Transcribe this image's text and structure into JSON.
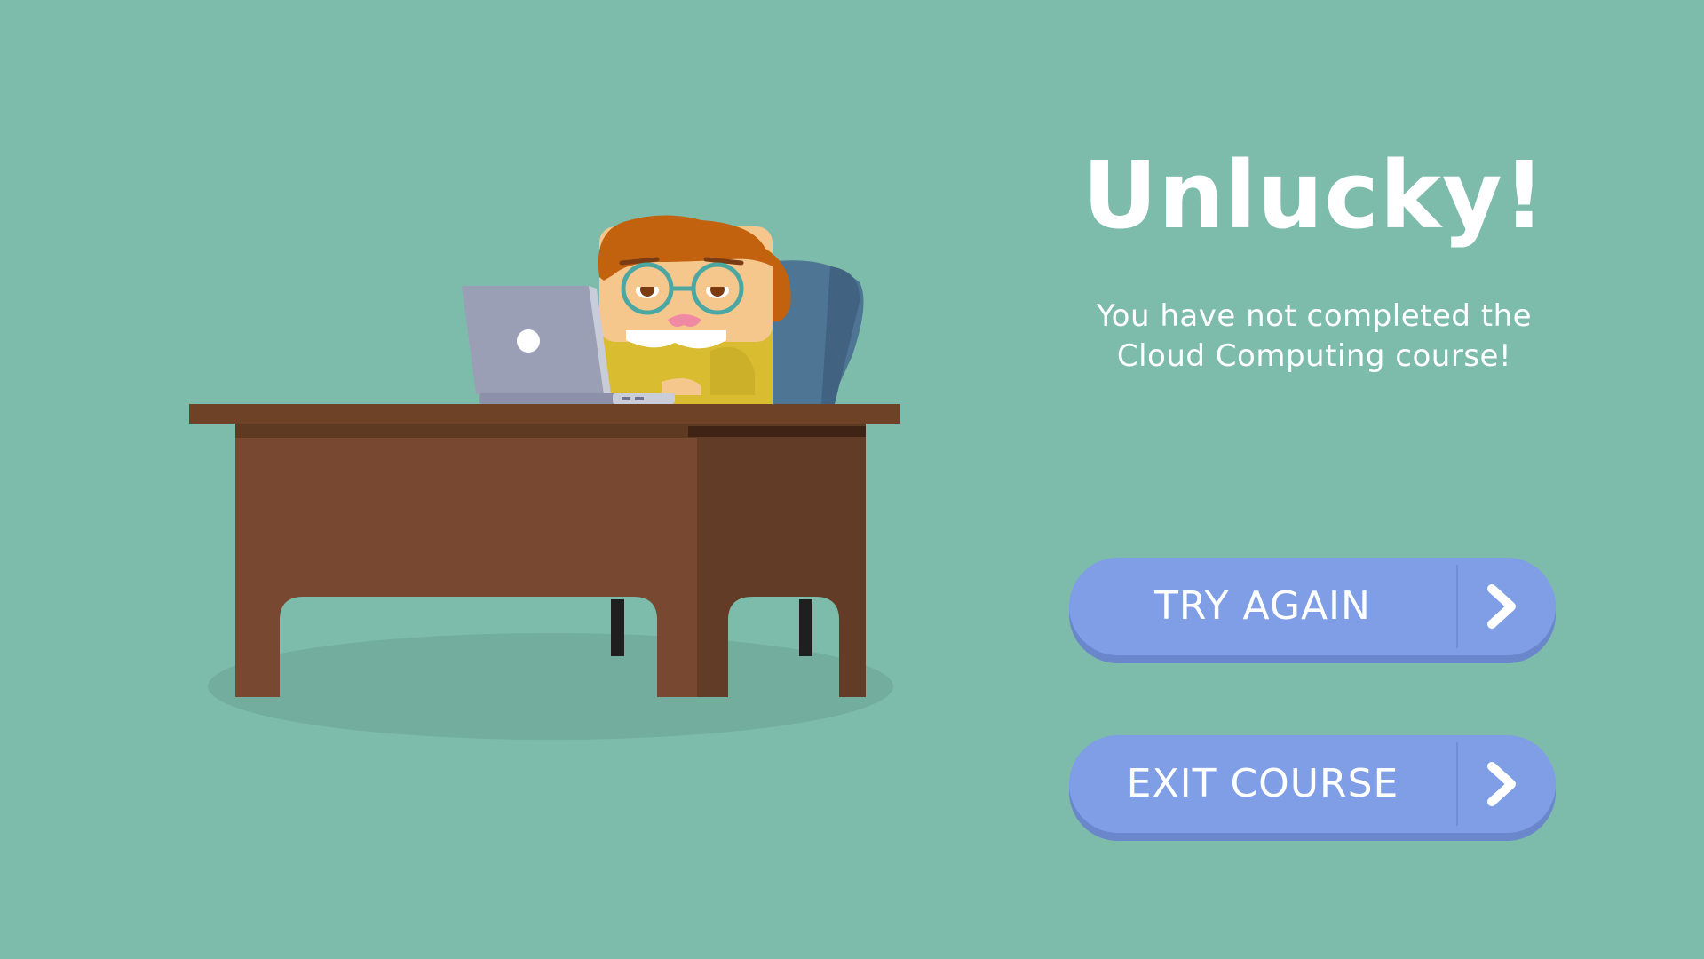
{
  "result": {
    "title": "Unlucky!",
    "message_line1": "You have not completed the",
    "message_line2": "Cloud Computing course!"
  },
  "buttons": {
    "try_again_label": "TRY AGAIN",
    "exit_course_label": "EXIT COURSE",
    "arrow_icon": "chevron-right-icon"
  },
  "colors": {
    "background": "#7dbcab",
    "button": "#7f9ee6",
    "button_shadow": "#6a87cc",
    "text": "#ffffff"
  },
  "illustration": {
    "subject": "character-at-desk-with-laptop",
    "icons": [
      "desk-icon",
      "laptop-icon",
      "chair-icon",
      "character-icon"
    ]
  }
}
